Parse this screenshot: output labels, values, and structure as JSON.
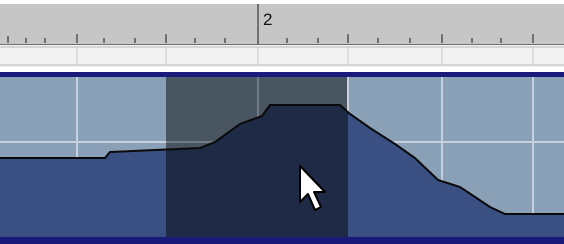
{
  "timeline": {
    "ruler": {
      "bar_label": "2"
    }
  },
  "track": {
    "envelope_type": "automation-envelope",
    "selection": "highlighted-time-range"
  },
  "pointer": {
    "icon": "arrow-cursor-icon"
  },
  "colors": {
    "ruler_bg": "#c6c6c6",
    "lane_bg": "#8aa0b6",
    "lane_fill": "#3a4f82",
    "selection_bg": "#4a5562",
    "selection_fill": "#1f2a47",
    "border": "#1a1a7a",
    "envelope_line": "#0a0a0a"
  }
}
